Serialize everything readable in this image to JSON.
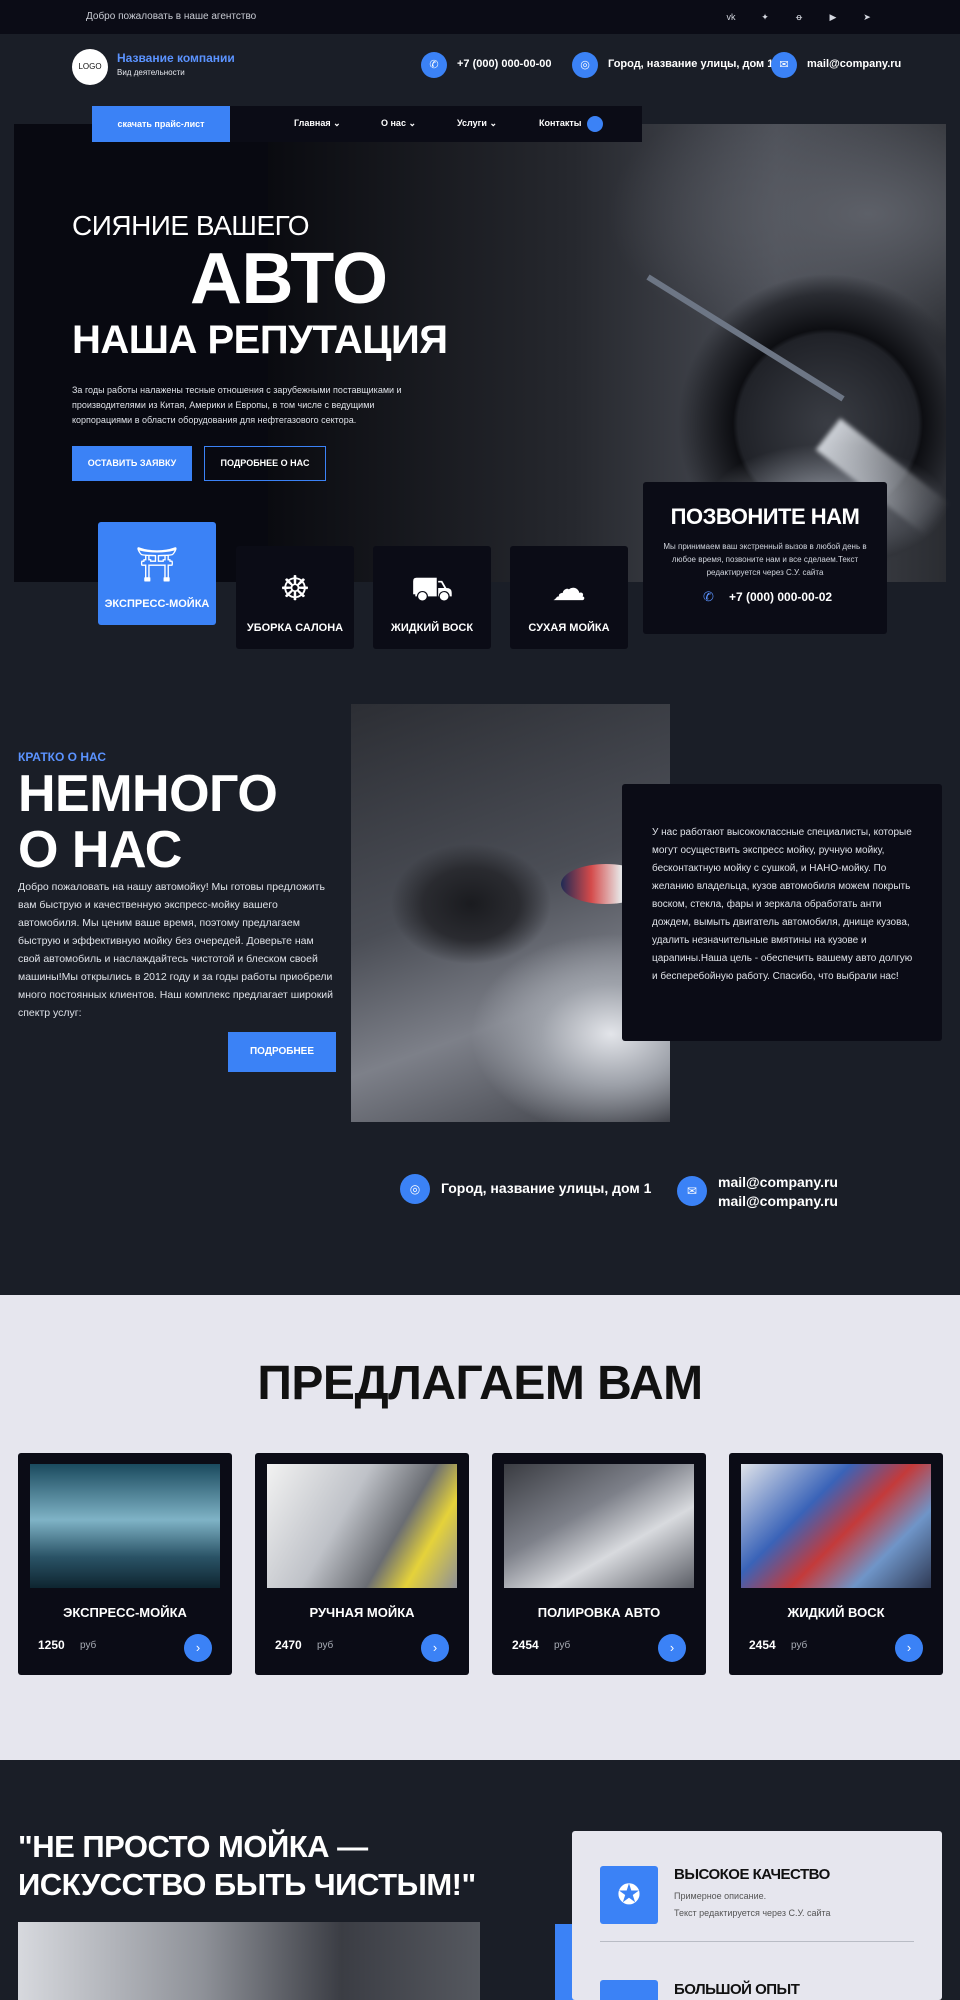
{
  "topbar": {
    "welcome": "Добро пожаловать в наше агентство",
    "socials": [
      {
        "name": "vk-icon",
        "glyph": "vk"
      },
      {
        "name": "twitter-icon",
        "glyph": "✦"
      },
      {
        "name": "ok-icon",
        "glyph": "ꝋ"
      },
      {
        "name": "youtube-icon",
        "glyph": "▶"
      },
      {
        "name": "telegram-icon",
        "glyph": "➤"
      }
    ]
  },
  "header": {
    "logo": "LOGO",
    "company": "Название компании",
    "activity": "Вид деятельности",
    "phone": "+7 (000) 000-00-00",
    "address": "Город, название улицы, дом 1",
    "email": "mail@company.ru"
  },
  "nav": {
    "price_button": "скачать прайс-лист",
    "items": [
      "Главная",
      "О нас",
      "Услуги",
      "Контакты"
    ]
  },
  "hero": {
    "line1": "СИЯНИЕ ВАШЕГО",
    "line2": "АВТО",
    "line3": "НАША РЕПУТАЦИЯ",
    "description": "За годы работы налажены тесные отношения с зарубежными поставщиками и производителями из Китая, Америки и Европы, в том числе с ведущими корпорациями в области оборудования для нефтегазового сектора.",
    "btn_order": "ОСТАВИТЬ ЗАЯВКУ",
    "btn_more": "ПОДРОБНЕЕ О НАС"
  },
  "services": [
    {
      "label": "ЭКСПРЕСС-МОЙКА",
      "icon": "car-wash-icon",
      "active": true
    },
    {
      "label": "УБОРКА САЛОНА",
      "icon": "steering-wheel-icon",
      "active": false
    },
    {
      "label": "ЖИДКИЙ ВОСК",
      "icon": "car-icon",
      "active": false
    },
    {
      "label": "СУХАЯ МОЙКА",
      "icon": "foam-car-icon",
      "active": false
    }
  ],
  "call": {
    "title": "ПОЗВОНИТЕ НАМ",
    "text": "Мы принимаем ваш экстренный вызов в любой день в любое время, позвоните нам и все сделаем.Текст редактируется через С.У. сайта",
    "phone": "+7 (000) 000-00-02"
  },
  "about": {
    "kicker": "КРАТКО О НАС",
    "title": "НЕМНОГО О НАС",
    "text": "Добро пожаловать на нашу автомойку! Мы готовы предложить вам быструю и качественную экспресс-мойку вашего автомобиля. Мы ценим ваше время, поэтому предлагаем быструю и эффективную мойку без очередей. Доверьте нам свой автомобиль и наслаждайтесь чистотой и блеском своей машины!Мы открылись в 2012 году и за годы работы приобрели много постоянных клиентов. Наш комплекс предлагает широкий спектр услуг:",
    "button": "ПОДРОБНЕЕ",
    "card_text": "У нас работают высококлассные специалисты, которые могут осуществить экспресс мойку, ручную мойку, бесконтактную мойку с сушкой, и НАНО-мойку. По желанию владельца, кузов автомобиля можем покрыть воском, стекла, фары и зеркала обработать анти дождем, вымыть двигатель автомобиля, днище кузова, удалить незначительные вмятины на кузове и царапины.Наша цель - обеспечить вашему авто долгую и бесперебойную работу. Спасибо, что выбрали нас!",
    "address": "Город, название улицы, дом 1",
    "email1": "mail@company.ru",
    "email2": "mail@company.ru"
  },
  "offers": {
    "title": "ПРЕДЛАГАЕМ ВАМ",
    "currency": "руб",
    "items": [
      {
        "name": "ЭКСПРЕСС-МОЙКА",
        "price": "1250"
      },
      {
        "name": "РУЧНАЯ МОЙКА",
        "price": "2470"
      },
      {
        "name": "ПОЛИРОВКА АВТО",
        "price": "2454"
      },
      {
        "name": "ЖИДКИЙ ВОСК",
        "price": "2454"
      }
    ]
  },
  "bottom": {
    "quote": "\"НЕ ПРОСТО МОЙКА — ИСКУССТВО БЫТЬ ЧИСТЫМ!\"",
    "features": [
      {
        "title": "ВЫСОКОЕ КАЧЕСТВО",
        "desc1": "Примерное описание.",
        "desc2": "Текст редактируется через С.У. сайта",
        "icon": "medal-icon"
      },
      {
        "title": "БОЛЬШОЙ ОПЫТ",
        "icon": "book-icon"
      }
    ]
  },
  "colors": {
    "accent": "#3b82f6",
    "dark": "#0b0c16",
    "page": "#1a1e27",
    "light": "#e6e6ee"
  }
}
